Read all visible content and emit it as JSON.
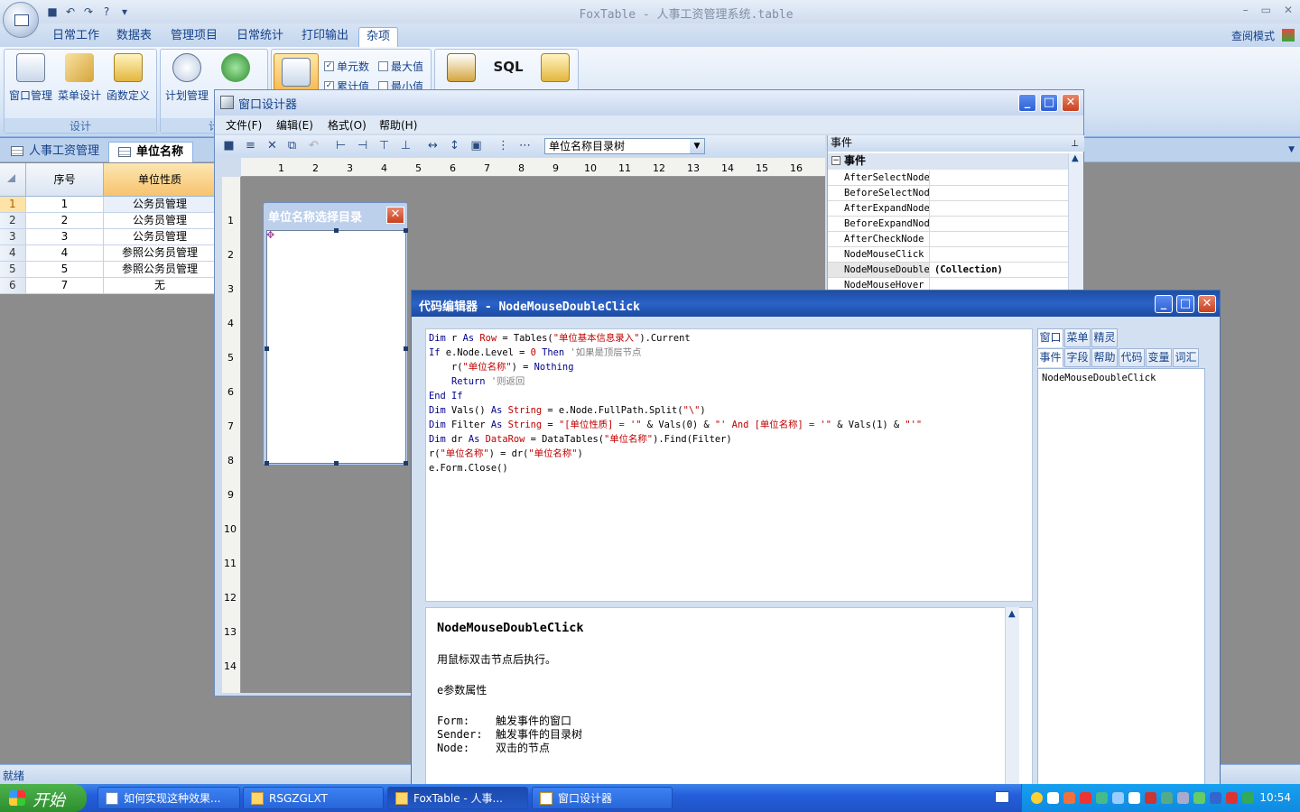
{
  "app": {
    "title": "FoxTable - 人事工资管理系统.table",
    "mode_label": "查阅模式"
  },
  "ribbon_tabs": [
    "日常工作",
    "数据表",
    "管理项目",
    "日常统计",
    "打印输出",
    "杂项"
  ],
  "ribbon_active_tab": "杂项",
  "ribbon": {
    "group_design": {
      "label": "设计",
      "buttons": [
        "窗口管理",
        "菜单设计",
        "函数定义"
      ]
    },
    "group_plan": {
      "label": "计",
      "buttons": [
        "计划管理"
      ]
    },
    "checkboxes": [
      {
        "label": "单元数",
        "checked": true
      },
      {
        "label": "最大值",
        "checked": false
      },
      {
        "label": "累计值",
        "checked": true
      },
      {
        "label": "最小值",
        "checked": false
      }
    ],
    "sql_label": "SQL"
  },
  "doc_tabs": [
    "人事工资管理",
    "单位名称"
  ],
  "grid": {
    "columns": [
      "序号",
      "单位性质"
    ],
    "rows": [
      {
        "n": "1",
        "id": "1",
        "type": "公务员管理"
      },
      {
        "n": "2",
        "id": "2",
        "type": "公务员管理"
      },
      {
        "n": "3",
        "id": "3",
        "type": "公务员管理"
      },
      {
        "n": "4",
        "id": "4",
        "type": "参照公务员管理"
      },
      {
        "n": "5",
        "id": "5",
        "type": "参照公务员管理"
      },
      {
        "n": "6",
        "id": "7",
        "type": "无"
      }
    ]
  },
  "status": "就绪",
  "designer": {
    "title": "窗口设计器",
    "menu": [
      "文件(F)",
      "编辑(E)",
      "格式(O)",
      "帮助(H)"
    ],
    "control_select": "单位名称目录树",
    "ruler_h": [
      "1",
      "2",
      "3",
      "4",
      "5",
      "6",
      "7",
      "8",
      "9",
      "10",
      "11",
      "12",
      "13",
      "14",
      "15",
      "16"
    ],
    "ruler_v": [
      "1",
      "2",
      "3",
      "4",
      "5",
      "6",
      "7",
      "8",
      "9",
      "10",
      "11",
      "12",
      "13",
      "14"
    ],
    "form_title": "单位名称选择目录",
    "props": {
      "header": "事件",
      "category": "事件",
      "rows": [
        {
          "name": "AfterSelectNode",
          "value": ""
        },
        {
          "name": "BeforeSelectNode",
          "value": ""
        },
        {
          "name": "AfterExpandNode",
          "value": ""
        },
        {
          "name": "BeforeExpandNode",
          "value": ""
        },
        {
          "name": "AfterCheckNode",
          "value": ""
        },
        {
          "name": "NodeMouseClick",
          "value": ""
        },
        {
          "name": "NodeMouseDoubleClick",
          "value": "(Collection)"
        },
        {
          "name": "NodeMouseHover",
          "value": ""
        }
      ]
    }
  },
  "code_editor": {
    "title": "代码编辑器 - NodeMouseDoubleClick",
    "side_tabs_row1": [
      "窗口",
      "菜单",
      "精灵"
    ],
    "side_tabs_row2": [
      "事件",
      "字段",
      "帮助",
      "代码",
      "变量",
      "词汇"
    ],
    "side_list": [
      "NodeMouseDoubleClick"
    ],
    "help": {
      "title": "NodeMouseDoubleClick",
      "desc": "用鼠标双击节点后执行。",
      "params_title": "e参数属性",
      "params": [
        "Form:    触发事件的窗口",
        "Sender:  触发事件的目录树",
        "Node:    双击的节点"
      ]
    }
  },
  "taskbar": {
    "start": "开始",
    "tasks": [
      "如何实现这种效果...",
      "RSGZGLXT",
      "FoxTable - 人事...",
      "窗口设计器"
    ],
    "clock": "10:54"
  }
}
